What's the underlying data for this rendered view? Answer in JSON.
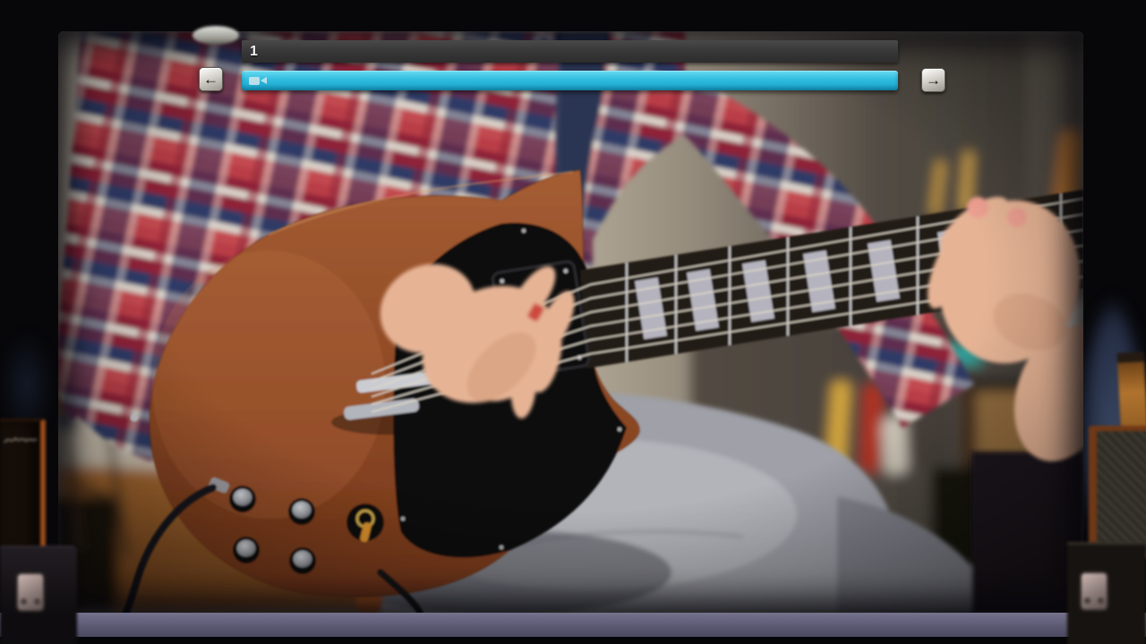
{
  "app": {
    "title": "guitar-lesson-video-player"
  },
  "player": {
    "section_label": "1",
    "progress_percent": "100%",
    "progress_fill_style": "width:100%",
    "nav_prev_glyph": "←",
    "nav_next_glyph": "→"
  },
  "icons": {
    "camera": "video-camera-icon",
    "prev": "arrow-left-icon",
    "next": "arrow-right-icon"
  },
  "colors": {
    "accent_cyan": "#2bb9dd",
    "track_gray": "#363636",
    "button_silver": "#d6d3cd",
    "ledge_purple": "#605e78",
    "room_black": "#07070a"
  },
  "scene": {
    "video_subject": "guitarist playing electric guitar in studio"
  }
}
